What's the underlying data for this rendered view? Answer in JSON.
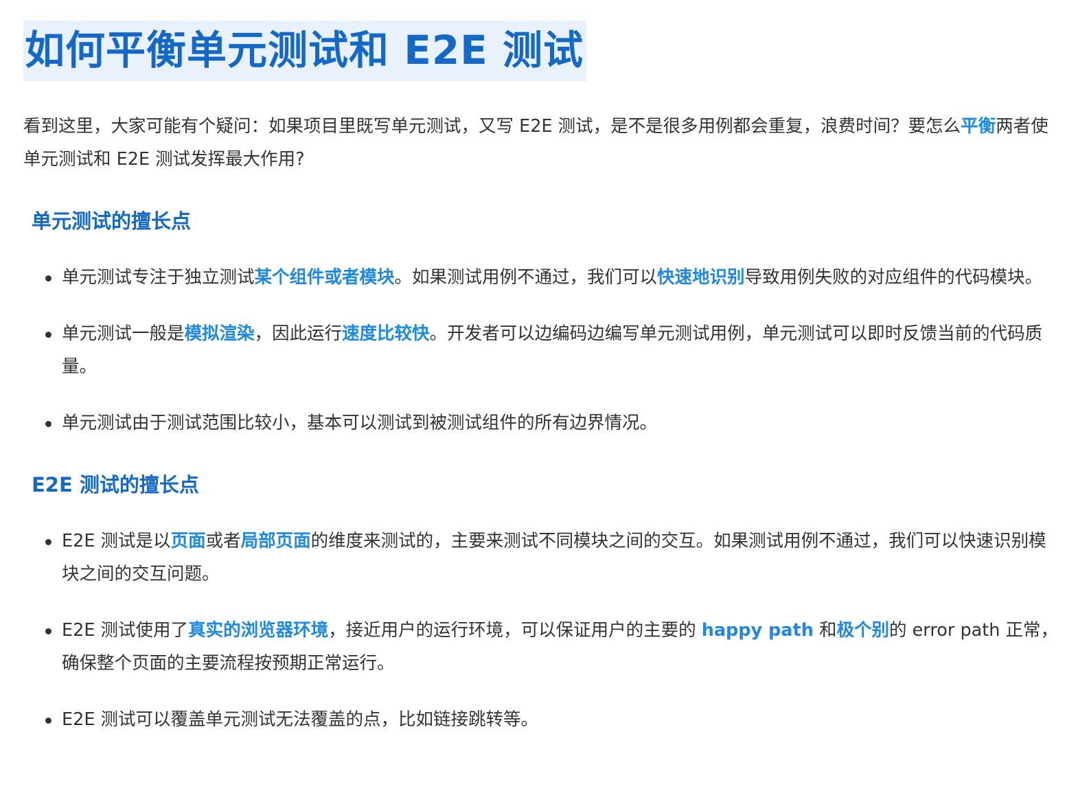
{
  "title": "如何平衡单元测试和 E2E 测试",
  "intro": {
    "p1": "看到这里，大家可能有个疑问：如果项目里既写单元测试，又写 E2E 测试，是不是很多用例都会重复，浪费时间？要怎么",
    "hl1": "平衡",
    "p2": "两者使单元测试和 E2E 测试发挥最大作用?"
  },
  "sections": [
    {
      "heading": "单元测试的擅长点",
      "items": [
        {
          "t1": "单元测试专注于独立测试",
          "h1": "某个组件或者模块",
          "t2": "。如果测试用例不通过，我们可以",
          "h2": "快速地识别",
          "t3": "导致用例失败的对应组件的代码模块。"
        },
        {
          "t1": "单元测试一般是",
          "h1": "模拟渲染",
          "t2": "，因此运行",
          "h2": "速度比较快",
          "t3": "。开发者可以边编码边编写单元测试用例，单元测试可以即时反馈当前的代码质量。"
        },
        {
          "t1": "单元测试由于测试范围比较小，基本可以测试到被测试组件的所有边界情况。"
        }
      ]
    },
    {
      "heading": "E2E 测试的擅长点",
      "items": [
        {
          "t1": "E2E 测试是以",
          "h1": "页面",
          "t2": "或者",
          "h2": "局部页面",
          "t3": "的维度来测试的，主要来测试不同模块之间的交互。如果测试用例不通过，我们可以快速识别模块之间的交互问题。"
        },
        {
          "t1": "E2E 测试使用了",
          "h1": "真实的浏览器环境",
          "t2": "，接近用户的运行环境，可以保证用户的主要的 ",
          "h2": "happy path",
          "t3": " 和",
          "h3": "极个别",
          "t4": "的 error path 正常，确保整个页面的主要流程按预期正常运行。"
        },
        {
          "t1": "E2E 测试可以覆盖单元测试无法覆盖的点，比如链接跳转等。"
        }
      ]
    }
  ],
  "colors": {
    "title": "#1368c8",
    "title_background": "#e8f1fc",
    "highlight": "#1e88e5",
    "body_text": "#333333"
  }
}
